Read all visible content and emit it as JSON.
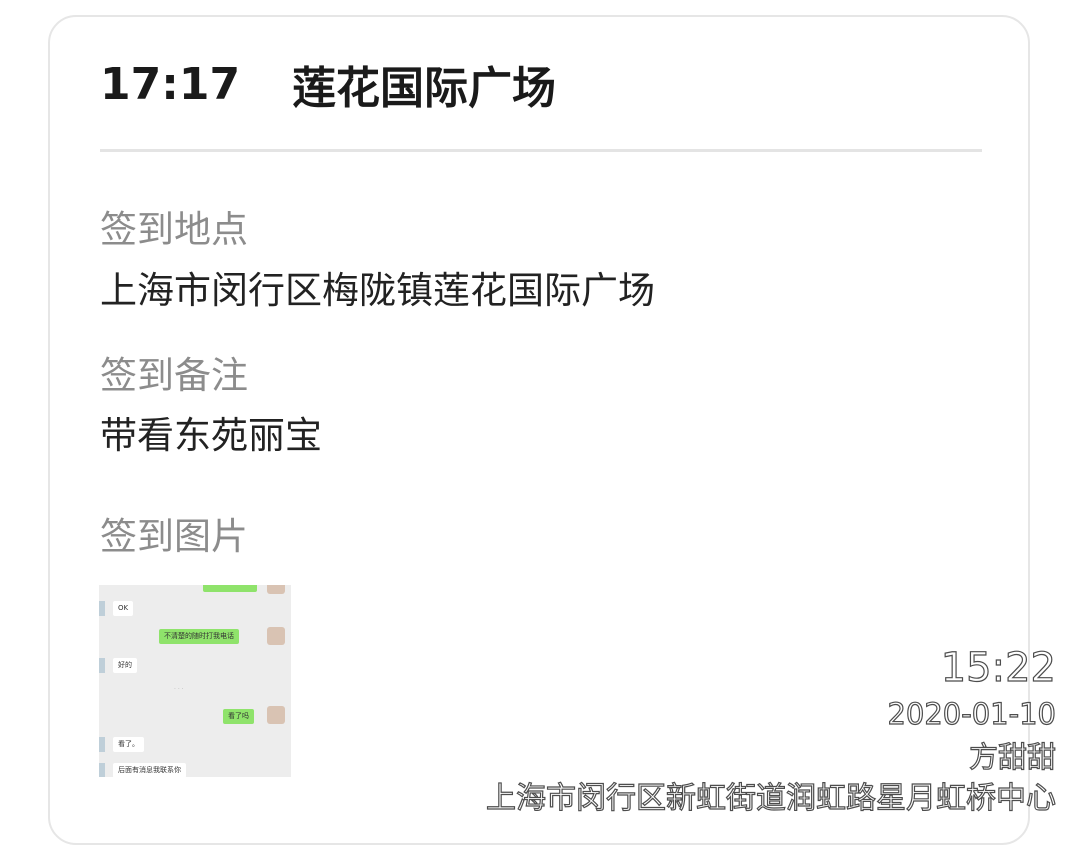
{
  "header": {
    "time": "17:17",
    "place": "莲花国际广场"
  },
  "checkin": {
    "location_label": "签到地点",
    "location_value": "上海市闵行区梅陇镇莲花国际广场",
    "note_label": "签到备注",
    "note_value": "带看东苑丽宝",
    "photo_label": "签到图片"
  },
  "thumbnail": {
    "messages": [
      {
        "side": "in",
        "text": "OK"
      },
      {
        "side": "out",
        "text": "不清楚的随时打我电话"
      },
      {
        "side": "in",
        "text": "好的"
      },
      {
        "side": "out",
        "text": "看了吗"
      },
      {
        "side": "in",
        "text": "看了。"
      },
      {
        "side": "in",
        "text": "后面有消息我联系你"
      }
    ]
  },
  "watermark": {
    "time": "15:22",
    "date": "2020-01-10",
    "name": "方甜甜",
    "address": "上海市闵行区新虹街道润虹路星月虹桥中心"
  },
  "colors": {
    "accent_green": "#8fe36b",
    "label_gray": "#8c8c8c",
    "text_dark": "#222222"
  }
}
